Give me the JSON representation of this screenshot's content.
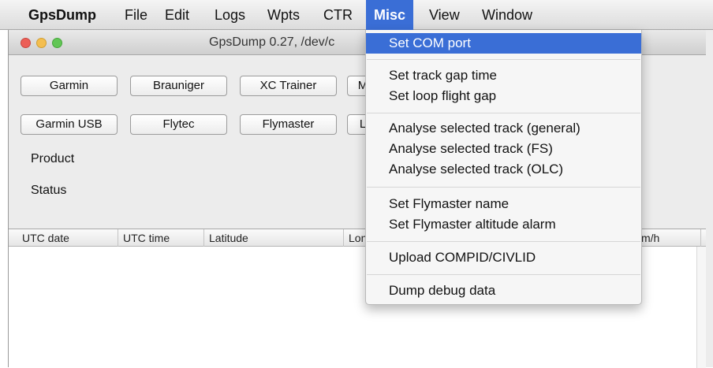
{
  "menubar": {
    "app": "GpsDump",
    "items": [
      "File",
      "Edit",
      "Logs",
      "Wpts",
      "CTR",
      "Misc",
      "View",
      "Window"
    ],
    "active": "Misc"
  },
  "window": {
    "title": "GpsDump 0.27, /dev/c"
  },
  "buttons": {
    "row1": [
      "Garmin",
      "Brauniger",
      "XC Trainer",
      "M"
    ],
    "row2": [
      "Garmin USB",
      "Flytec",
      "Flymaster",
      "L"
    ]
  },
  "labels": {
    "product": "Product",
    "status": "Status"
  },
  "table": {
    "columns": [
      "UTC date",
      "UTC time",
      "Latitude",
      "Lon",
      "",
      "m/h"
    ]
  },
  "misc_menu": {
    "groups": [
      [
        "Set COM port"
      ],
      [
        "Set track gap time",
        "Set loop flight gap"
      ],
      [
        "Analyse selected track (general)",
        "Analyse selected track (FS)",
        "Analyse selected track (OLC)"
      ],
      [
        "Set Flymaster name",
        "Set Flymaster altitude alarm"
      ],
      [
        "Upload COMPID/CIVLID"
      ],
      [
        "Dump debug data"
      ]
    ],
    "highlighted": "Set COM port"
  }
}
